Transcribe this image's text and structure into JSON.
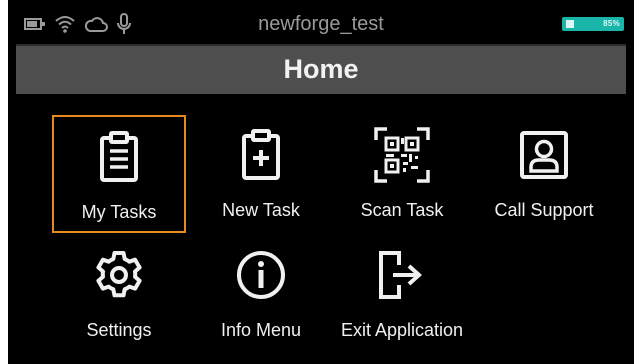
{
  "status_bar": {
    "device_name": "newforge_test",
    "icons": [
      "battery-small-icon",
      "wifi-icon",
      "cloud-icon",
      "microphone-icon"
    ],
    "battery_label": "85%",
    "accent_color": "#19b5a8"
  },
  "header": {
    "title": "Home"
  },
  "menu": {
    "selected_color": "#e8891e",
    "items": [
      {
        "label": "My Tasks",
        "icon": "clipboard-list-icon",
        "selected": true
      },
      {
        "label": "New Task",
        "icon": "clipboard-plus-icon",
        "selected": false
      },
      {
        "label": "Scan Task",
        "icon": "qr-code-icon",
        "selected": false
      },
      {
        "label": "Call Support",
        "icon": "contact-card-icon",
        "selected": false
      },
      {
        "label": "Settings",
        "icon": "gear-icon",
        "selected": false
      },
      {
        "label": "Info Menu",
        "icon": "info-icon",
        "selected": false
      },
      {
        "label": "Exit Application",
        "icon": "exit-icon",
        "selected": false
      }
    ]
  }
}
